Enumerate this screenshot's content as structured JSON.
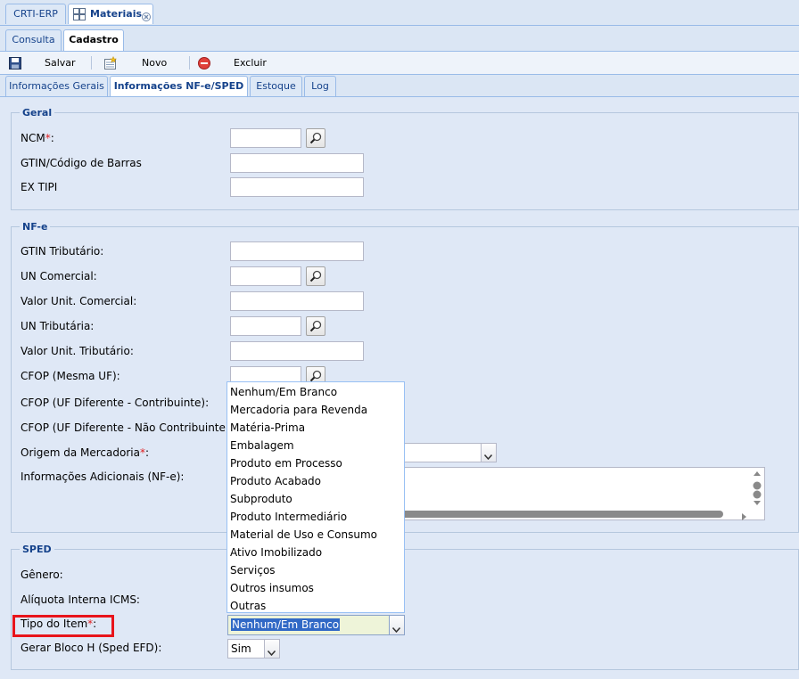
{
  "top_tabs": [
    {
      "label": "CRTI-ERP"
    },
    {
      "label": "Materiais"
    }
  ],
  "sub_tabs": [
    {
      "label": "Consulta"
    },
    {
      "label": "Cadastro"
    }
  ],
  "toolbar": {
    "save_label": "Salvar",
    "new_label": "Novo",
    "delete_label": "Excluir"
  },
  "section_tabs": [
    {
      "label": "Informações Gerais"
    },
    {
      "label": "Informações NF-e/SPED"
    },
    {
      "label": "Estoque"
    },
    {
      "label": "Log"
    }
  ],
  "geral": {
    "legend": "Geral",
    "ncm": "NCM",
    "gtin": "GTIN/Código de Barras",
    "ex_tipi": "EX TIPI"
  },
  "nfe": {
    "legend": "NF-e",
    "gtin_trib": "GTIN Tributário:",
    "un_comercial": "UN Comercial:",
    "valor_unit_comercial": "Valor Unit. Comercial:",
    "un_tributaria": "UN Tributária:",
    "valor_unit_tributario": "Valor Unit. Tributário:",
    "cfop_mesma_uf": "CFOP (Mesma UF):",
    "cfop_uf_dif_contrib": "CFOP (UF Diferente - Contribuinte):",
    "cfop_uf_dif_nao_contrib": "CFOP (UF Diferente - Não Contribuinte):",
    "origem": "Origem da Mercadoria",
    "info_adicionais": "Informações Adicionais (NF-e):"
  },
  "sped": {
    "legend": "SPED",
    "genero": "Gênero:",
    "aliquota": "Alíquota Interna ICMS:",
    "tipo_item": "Tipo do Item",
    "tipo_item_value": "Nenhum/Em Branco",
    "gerar_bloco_h": "Gerar Bloco H (Sped EFD):",
    "gerar_bloco_h_value": "Sim"
  },
  "dropdown_options": [
    "Nenhum/Em Branco",
    "Mercadoria para Revenda",
    "Matéria-Prima",
    "Embalagem",
    "Produto em Processo",
    "Produto Acabado",
    "Subproduto",
    "Produto Intermediário",
    "Material de Uso e Consumo",
    "Ativo Imobilizado",
    "Serviços",
    "Outros insumos",
    "Outras"
  ],
  "colors": {
    "accent": "#15428b",
    "required": "#e02020",
    "highlight": "#e8141b",
    "selection": "#3169c6"
  }
}
